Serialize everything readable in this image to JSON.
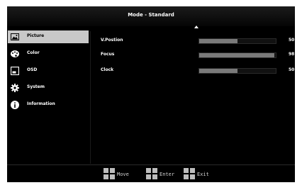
{
  "header": {
    "title": "Mode - Standard"
  },
  "sidebar": {
    "items": [
      {
        "label": "Picture",
        "icon": "picture-icon",
        "active": true
      },
      {
        "label": "Color",
        "icon": "color-palette-icon",
        "active": false
      },
      {
        "label": "OSD",
        "icon": "osd-icon",
        "active": false
      },
      {
        "label": "System",
        "icon": "gear-icon",
        "active": false
      },
      {
        "label": "Information",
        "icon": "info-icon",
        "active": false
      }
    ]
  },
  "settings": [
    {
      "label": "V.Postion",
      "value": "50",
      "fraction": 0.5
    },
    {
      "label": "Focus",
      "value": "98",
      "fraction": 0.98
    },
    {
      "label": "Clock",
      "value": "50",
      "fraction": 0.5
    }
  ],
  "footer": {
    "move": "Move",
    "enter": "Enter",
    "exit": "Exit"
  },
  "colors": {
    "background": "#000000",
    "active": "#c8c8c8",
    "bar_fill": "#7a7a7a"
  }
}
